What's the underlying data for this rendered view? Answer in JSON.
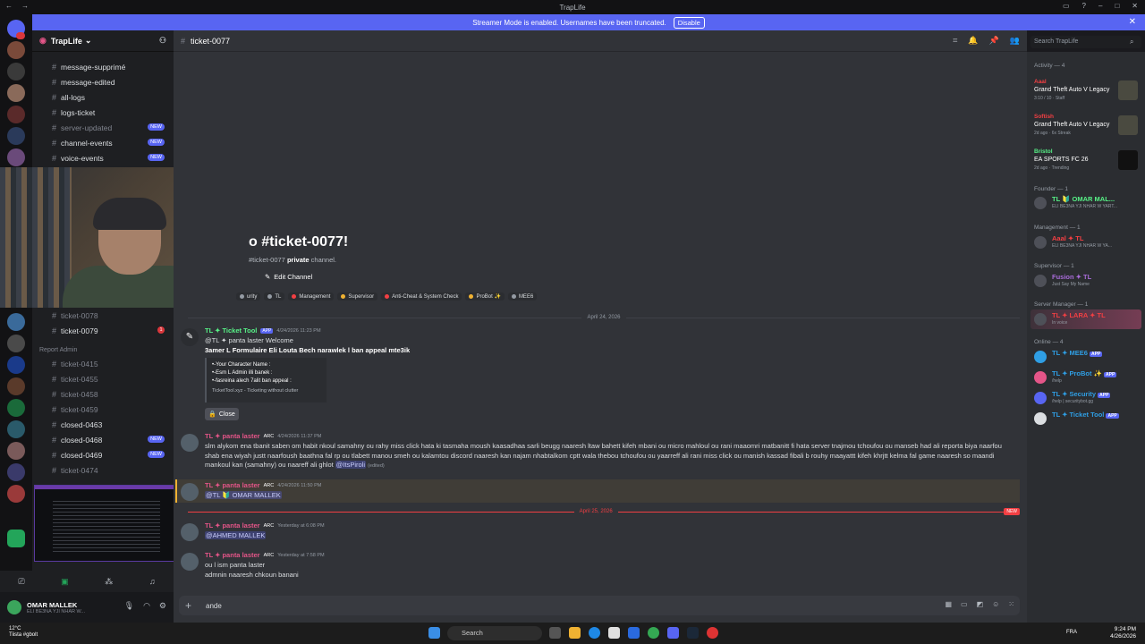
{
  "window": {
    "title": "TrapLife"
  },
  "banner": {
    "text": "Streamer Mode is enabled. Usernames have been truncated.",
    "button": "Disable"
  },
  "guild": {
    "name": "TrapLife"
  },
  "channels_top": [
    {
      "name": "message-supprimé",
      "muted": false,
      "badge": ""
    },
    {
      "name": "message-edited",
      "muted": false,
      "badge": ""
    },
    {
      "name": "all-logs",
      "muted": false,
      "badge": ""
    },
    {
      "name": "logs-ticket",
      "muted": false,
      "badge": ""
    },
    {
      "name": "server-updated",
      "muted": true,
      "badge": "NEW"
    },
    {
      "name": "channel-events",
      "muted": false,
      "badge": "NEW"
    },
    {
      "name": "voice-events",
      "muted": false,
      "badge": "NEW"
    }
  ],
  "channels_bottom": [
    {
      "name": "ticket-0078",
      "muted": true,
      "badge": ""
    },
    {
      "name": "ticket-0079",
      "muted": false,
      "badge": "1"
    }
  ],
  "category_report": "Report Admin",
  "channels_report": [
    {
      "name": "ticket-0415",
      "muted": true,
      "badge": ""
    },
    {
      "name": "ticket-0455",
      "muted": true,
      "badge": ""
    },
    {
      "name": "ticket-0458",
      "muted": true,
      "badge": ""
    },
    {
      "name": "ticket-0459",
      "muted": true,
      "badge": ""
    },
    {
      "name": "closed-0463",
      "muted": false,
      "badge": ""
    },
    {
      "name": "closed-0468",
      "muted": false,
      "badge": "NEW"
    },
    {
      "name": "closed-0469",
      "muted": false,
      "badge": "NEW"
    },
    {
      "name": "ticket-0474",
      "muted": true,
      "badge": ""
    }
  ],
  "user": {
    "name": "OMAR MALLEK",
    "status": "ELI BE3NA YJI NHAR W..."
  },
  "channel": {
    "name": "ticket-0077"
  },
  "welcome": {
    "title": "o #ticket-0077!",
    "sub_prefix": "#ticket-0077 ",
    "sub_bold": "private",
    "sub_suffix": " channel.",
    "edit": "Edit Channel",
    "tags": [
      "urity",
      "TL",
      "Management",
      "Supervisor",
      "Anti-Cheat & System Check",
      "ProBot ✨",
      "MEE6"
    ]
  },
  "dates": {
    "d1": "April 24, 2026",
    "d2": "April 25, 2026",
    "new": "NEW"
  },
  "messages": [
    {
      "author": "TL ✦ Ticket Tool",
      "tag": "APP",
      "time": "4/24/2026 11:23 PM",
      "line1": "@TL ✦ panta laster Welcome",
      "line2": "3amer L Formulaire Eli Louta Bech narawlek l ban appeal mte3ik"
    },
    {
      "author": "TL ✦ panta laster",
      "tag": "ARC",
      "time": "4/24/2026 11:37 PM",
      "text": "slm alykom ena tbanit saben om habit nkoul samahny ou rahy miss click hata ki tasmaha moush kaasadhaa sarli beugg naaresh ltaw bahett kifeh mbani ou micro mahloul ou rani maaomri matbanitt fi hata server tnajmou tchoufou ou manseb had ali reporta biya naarfou shab ena wiyah justt naarfoush baathna fal rp ou tlabett manou smeh ou kalamtou discord naaresh kan najam nhabtalkom cptt wala thebou tchoufou ou yaarreff ali rani miss click ou manish kassad fibali b rouhy maayattt kifeh khrjtt kelma fal game naaresh so maandi mankoul kan (samahny) ou naareff ali ghlot",
      "mention": "@ItsPiroli",
      "edited": "(edited)"
    },
    {
      "author": "TL ✦ panta laster",
      "tag": "ARC",
      "time": "4/24/2026 11:50 PM",
      "mention": "@TL 🔰 OMAR MALLEK"
    },
    {
      "author": "TL ✦ panta laster",
      "tag": "ARC",
      "time": "Yesterday at 6:08 PM",
      "mention": "@AHMED MALLEK"
    },
    {
      "author": "TL ✦ panta laster",
      "tag": "ARC",
      "time": "Yesterday at 7:58 PM",
      "line1": "ou l ism panta laster",
      "line2": "admnin naaresh chkoun banani"
    }
  ],
  "embed": {
    "l1": "•-Your Character Name :",
    "l2": "•-Esm L Admin illi banek :",
    "l3": "•-fasreina alech 7alit ban appeal :",
    "foot": "TicketTool.xyz - Ticketing without clutter",
    "close": "Close"
  },
  "composer": {
    "value": "ande"
  },
  "search": {
    "placeholder": "Search TrapLife"
  },
  "members": {
    "activity_head": "Activity — 4",
    "activities": [
      {
        "name": "Aaal",
        "game": "Grand Theft Auto V Legacy",
        "sub": "3:10 / 10 · Staff"
      },
      {
        "name": "Softish",
        "game": "Grand Theft Auto V Legacy",
        "sub": "2d ago · 6x Streak"
      },
      {
        "name": "Bristol",
        "game": "EA SPORTS FC 26",
        "sub": "2d ago · Trending"
      }
    ],
    "founder_head": "Founder — 1",
    "founder": {
      "name": "TL 🔰 OMAR MAL...",
      "sub": "ELI BE3NA YJI NHAR W YART..."
    },
    "management_head": "Management — 1",
    "management": {
      "name": "Aaal ✦ TL",
      "sub": "ELI BE3NA YJI NHAR W YA..."
    },
    "supervisor_head": "Supervisor — 1",
    "supervisor": {
      "name": "Fusion ✦ TL",
      "sub": "Just Say My Name"
    },
    "servermgr_head": "Server Manager — 1",
    "servermgr": {
      "name": "TL ✦ LARA ✦ TL",
      "sub": "In voice"
    },
    "online_head": "Online — 4",
    "online": [
      {
        "name": "TL ✦ MEE6",
        "tag": "APP",
        "sub": ""
      },
      {
        "name": "TL ✦ ProBot ✨",
        "tag": "APP",
        "sub": "/help"
      },
      {
        "name": "TL ✦ Security",
        "tag": "APP",
        "sub": "/help | securitybot.gg"
      },
      {
        "name": "TL ✦ Ticket Tool",
        "tag": "APP",
        "sub": ""
      }
    ]
  },
  "taskbar": {
    "temp": "12°C",
    "weather": "Tiista #gbolt",
    "search": "Search",
    "lang": "FRA",
    "time": "9:24 PM",
    "date": "4/26/2026"
  },
  "colors": {
    "accent": "#5865f2",
    "pink": "#e45588",
    "red": "#f23f43"
  }
}
